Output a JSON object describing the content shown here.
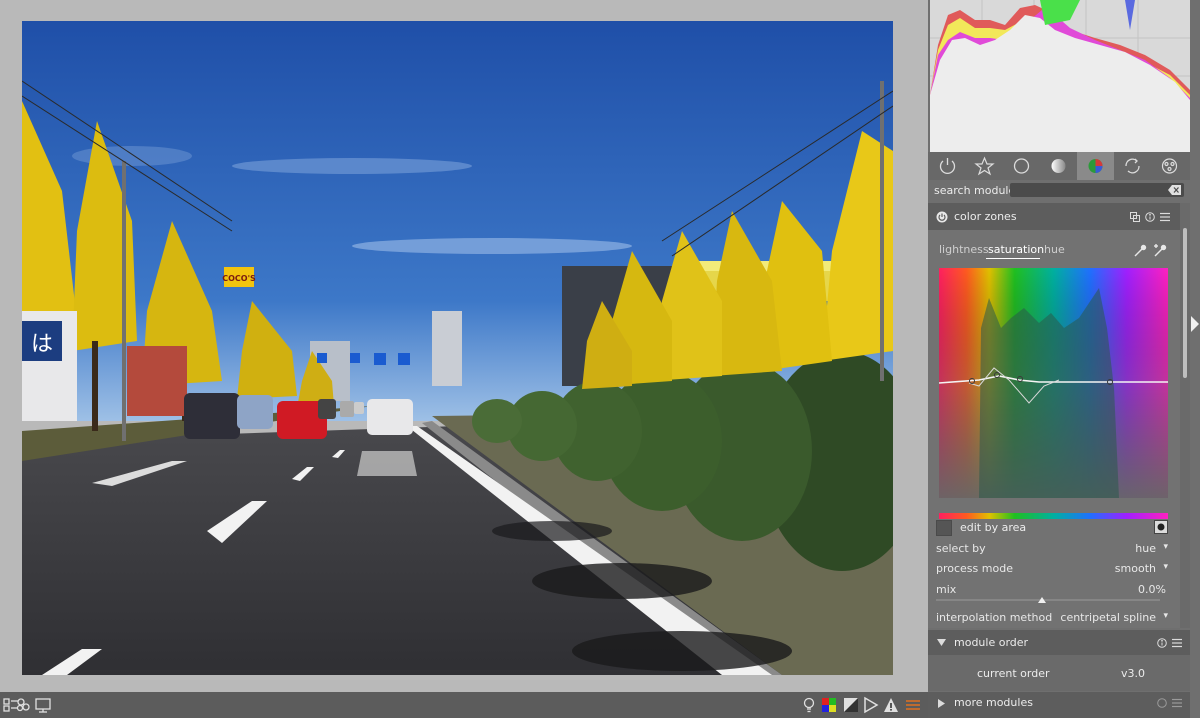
{
  "panel": {
    "search_label": "search module",
    "module_title": "color zones",
    "tabs": [
      {
        "label": "lightness",
        "active": false
      },
      {
        "label": "saturation",
        "active": true
      },
      {
        "label": "hue",
        "active": false
      }
    ],
    "edit_by_area": "edit by area",
    "rows": [
      {
        "label": "select by",
        "value": "hue"
      },
      {
        "label": "process mode",
        "value": "smooth"
      },
      {
        "label": "mix",
        "value": "0.0%"
      },
      {
        "label": "interpolation method",
        "value": "centripetal spline"
      }
    ],
    "module_order_title": "module order",
    "current_order_label": "current order",
    "current_order_value": "v3.0",
    "more_modules_title": "more modules"
  },
  "module_groups": [
    {
      "name": "power-icon",
      "active": false
    },
    {
      "name": "star-icon",
      "active": false
    },
    {
      "name": "circle-icon",
      "active": false
    },
    {
      "name": "tone-icon",
      "active": false
    },
    {
      "name": "color-icon",
      "active": true
    },
    {
      "name": "correct-icon",
      "active": false
    },
    {
      "name": "effect-icon",
      "active": false
    }
  ],
  "colors": {
    "accent": "#ffffff",
    "panel_bg": "#6f6f6f",
    "header_bg": "#5d5d5d",
    "view_bg": "#b9b9b9"
  },
  "photo": {
    "sign_text": "COCO'S",
    "shop_sign": "は"
  }
}
